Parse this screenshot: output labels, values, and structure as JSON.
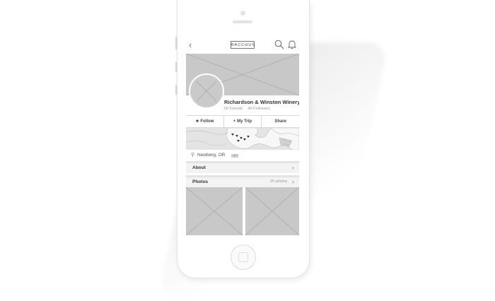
{
  "navbar": {
    "brand": "BACCHUS",
    "back_icon": "chevron-left-icon",
    "search_icon": "search-icon",
    "notifications_icon": "bell-icon"
  },
  "profile": {
    "name": "Richardson & Winston Winery",
    "friends": "50 Friends",
    "followers": "40 Followers"
  },
  "actions": [
    {
      "label": "★ Follow"
    },
    {
      "label": "+ My Trip"
    },
    {
      "label": "Share"
    }
  ],
  "location": {
    "text": "Newberg, OR"
  },
  "about": {
    "label": "About"
  },
  "photos": {
    "label": "Photos",
    "count": "20 photos"
  }
}
